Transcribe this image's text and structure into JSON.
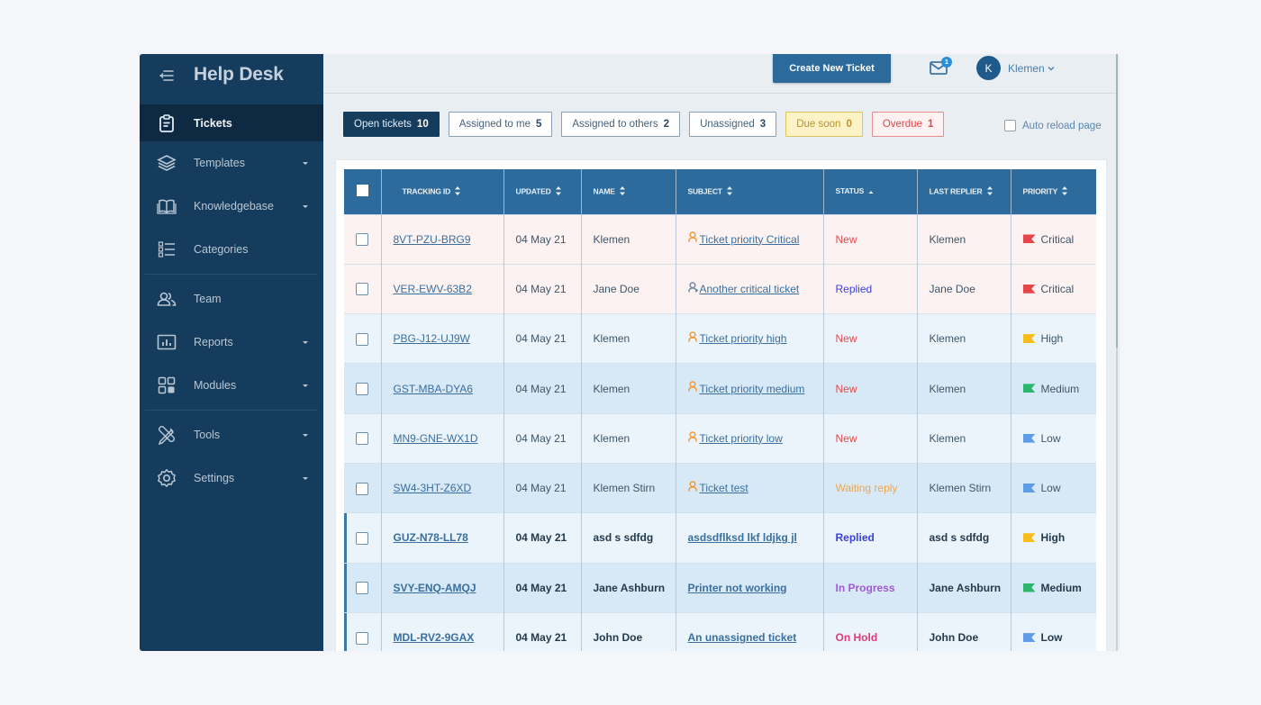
{
  "app": {
    "title": "Help Desk"
  },
  "sidebar": {
    "items": [
      {
        "label": "Tickets",
        "icon": "clipboard-icon",
        "active": true,
        "has_submenu": false
      },
      {
        "label": "Templates",
        "icon": "layers-icon",
        "has_submenu": true
      },
      {
        "label": "Knowledgebase",
        "icon": "book-icon",
        "has_submenu": true
      },
      {
        "label": "Categories",
        "icon": "list-icon",
        "has_submenu": false
      },
      {
        "label": "Team",
        "icon": "users-icon",
        "has_submenu": false
      },
      {
        "label": "Reports",
        "icon": "bar-chart-icon",
        "has_submenu": true
      },
      {
        "label": "Modules",
        "icon": "grid-icon",
        "has_submenu": true
      },
      {
        "label": "Tools",
        "icon": "tools-icon",
        "has_submenu": true
      },
      {
        "label": "Settings",
        "icon": "gear-icon",
        "has_submenu": true
      }
    ]
  },
  "topbar": {
    "create_button": "Create New Ticket",
    "mail_badge": "1",
    "user_initial": "K",
    "user_name": "Klemen"
  },
  "filters": [
    {
      "label": "Open tickets",
      "count": "10",
      "variant": "active"
    },
    {
      "label": "Assigned to me",
      "count": "5",
      "variant": "default"
    },
    {
      "label": "Assigned to others",
      "count": "2",
      "variant": "default"
    },
    {
      "label": "Unassigned",
      "count": "3",
      "variant": "default"
    },
    {
      "label": "Due soon",
      "count": "0",
      "variant": "warn"
    },
    {
      "label": "Overdue",
      "count": "1",
      "variant": "danger"
    }
  ],
  "auto_reload_label": "Auto reload page",
  "table": {
    "columns": [
      "TRACKING ID",
      "UPDATED",
      "NAME",
      "SUBJECT",
      "STATUS",
      "LAST REPLIER",
      "PRIORITY"
    ],
    "sorted_column": "STATUS",
    "rows": [
      {
        "id": "8VT-PZU-BRG9",
        "updated": "04 May 21",
        "name": "Klemen",
        "subject": "Ticket priority Critical",
        "subject_icon": "assigned-user-icon",
        "status": "New",
        "last_replier": "Klemen",
        "priority": "Critical",
        "style": "crit",
        "bold": false,
        "flagged": false
      },
      {
        "id": "VER-EWV-63B2",
        "updated": "04 May 21",
        "name": "Jane Doe",
        "subject": "Another critical ticket",
        "subject_icon": "assign-user-icon",
        "status": "Replied",
        "last_replier": "Jane Doe",
        "priority": "Critical",
        "style": "crit",
        "bold": false,
        "flagged": false
      },
      {
        "id": "PBG-J12-UJ9W",
        "updated": "04 May 21",
        "name": "Klemen",
        "subject": "Ticket priority high",
        "subject_icon": "assigned-user-icon",
        "status": "New",
        "last_replier": "Klemen",
        "priority": "High",
        "style": "alt1",
        "bold": false,
        "flagged": false
      },
      {
        "id": "GST-MBA-DYA6",
        "updated": "04 May 21",
        "name": "Klemen",
        "subject": "Ticket priority medium",
        "subject_icon": "assigned-user-icon",
        "status": "New",
        "last_replier": "Klemen",
        "priority": "Medium",
        "style": "alt2",
        "bold": false,
        "flagged": false
      },
      {
        "id": "MN9-GNE-WX1D",
        "updated": "04 May 21",
        "name": "Klemen",
        "subject": "Ticket priority low",
        "subject_icon": "assigned-user-icon",
        "status": "New",
        "last_replier": "Klemen",
        "priority": "Low",
        "style": "alt1",
        "bold": false,
        "flagged": false
      },
      {
        "id": "SW4-3HT-Z6XD",
        "updated": "04 May 21",
        "name": "Klemen Stirn",
        "subject": "Ticket test",
        "subject_icon": "assigned-user-icon",
        "status": "Waiting reply",
        "last_replier": "Klemen Stirn",
        "priority": "Low",
        "style": "alt2",
        "bold": false,
        "flagged": false
      },
      {
        "id": "GUZ-N78-LL78",
        "updated": "04 May 21",
        "name": "asd s sdfdg",
        "subject": "asdsdflksd lkf ldjkg jl",
        "subject_icon": "",
        "status": "Replied",
        "last_replier": "asd s sdfdg",
        "priority": "High",
        "style": "alt1",
        "bold": true,
        "flagged": true
      },
      {
        "id": "SVY-ENQ-AMQJ",
        "updated": "04 May 21",
        "name": "Jane Ashburn",
        "subject": "Printer not working",
        "subject_icon": "",
        "status": "In Progress",
        "last_replier": "Jane Ashburn",
        "priority": "Medium",
        "style": "alt2",
        "bold": true,
        "flagged": true
      },
      {
        "id": "MDL-RV2-9GAX",
        "updated": "04 May 21",
        "name": "John Doe",
        "subject": "An unassigned ticket",
        "subject_icon": "",
        "status": "On Hold",
        "last_replier": "John Doe",
        "priority": "Low",
        "style": "alt1",
        "bold": true,
        "flagged": true
      }
    ]
  },
  "colors": {
    "status": {
      "New": "#e8484b",
      "Replied": "#3b3fe0",
      "Waiting reply": "#f0a64a",
      "In Progress": "#a15ad6",
      "On Hold": "#e0397a"
    },
    "priority": {
      "Critical": "#e4474a",
      "High": "#f7bd1a",
      "Medium": "#2fb66d",
      "Low": "#5f9ce8"
    },
    "subject_icon": {
      "assigned-user-icon": "#f0983a",
      "assign-user-icon": "#6f8aa0"
    }
  }
}
